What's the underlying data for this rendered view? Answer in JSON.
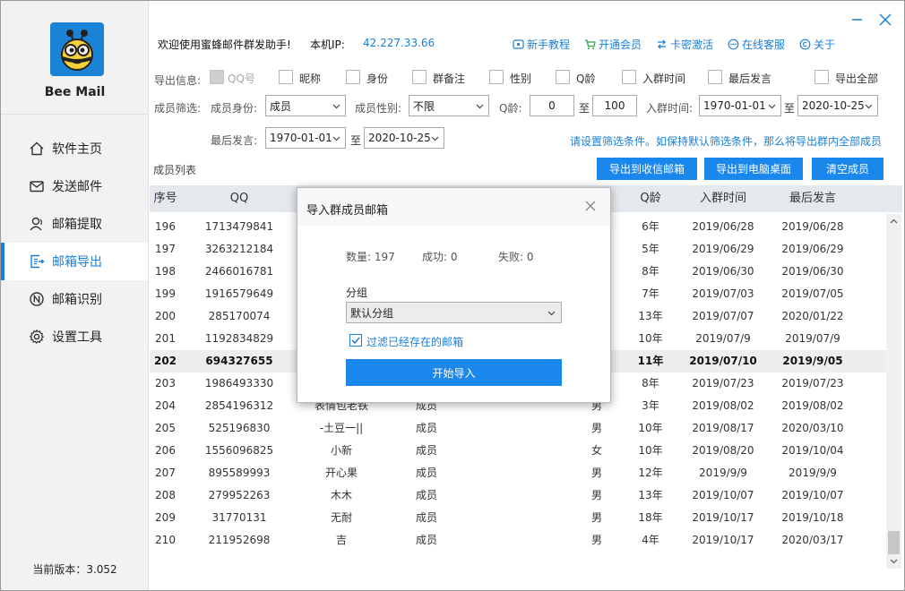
{
  "app": {
    "name": "Bee Mail",
    "version_text": "当前版本：3.052"
  },
  "sidebar": {
    "items": [
      {
        "label": "软件主页",
        "icon": "home-icon"
      },
      {
        "label": "发送邮件",
        "icon": "mail-icon"
      },
      {
        "label": "邮箱提取",
        "icon": "user-icon"
      },
      {
        "label": "邮箱导出",
        "icon": "export-icon"
      },
      {
        "label": "邮箱识别",
        "icon": "identify-icon"
      },
      {
        "label": "设置工具",
        "icon": "gear-icon"
      }
    ],
    "active_index": 3
  },
  "topbar": {
    "welcome": "欢迎使用蜜蜂邮件群发助手!",
    "ip_label": "本机IP:",
    "ip_value": "42.227.33.66",
    "links": [
      "新手教程",
      "开通会员",
      "卡密激活",
      "在线客服",
      "关于"
    ]
  },
  "export_info": {
    "label": "导出信息:",
    "options": [
      "QQ号",
      "昵称",
      "身份",
      "群备注",
      "性别",
      "Q龄",
      "入群时间",
      "最后发言",
      "导出全部"
    ]
  },
  "filter": {
    "label": "成员筛选:",
    "identity_label": "成员身份:",
    "identity_value": "成员",
    "gender_label": "成员性别:",
    "gender_value": "不限",
    "qage_label": "Q龄:",
    "qage_from": "0",
    "to": "至",
    "qage_to": "100",
    "join_label": "入群时间:",
    "join_from": "1970-01-01",
    "join_to": "2020-10-25",
    "last_label": "最后发言:",
    "last_from": "1970-01-01",
    "last_to": "2020-10-25",
    "hint": "请设置筛选条件。如保持默认筛选条件，那么将导出群内全部成员"
  },
  "list": {
    "title": "成员列表",
    "buttons": [
      "导出到收信邮箱",
      "导出到电脑桌面",
      "清空成员"
    ],
    "headers": [
      "序号",
      "QQ",
      "Q龄",
      "入群时间",
      "最后发言"
    ],
    "rows": [
      {
        "no": "196",
        "qq": "1713479841",
        "nick": "",
        "role": "",
        "sex": "",
        "age": "6年",
        "join": "2019/06/28",
        "last": "2019/06/28"
      },
      {
        "no": "197",
        "qq": "3263212184",
        "nick": "",
        "role": "",
        "sex": "",
        "age": "5年",
        "join": "2019/06/29",
        "last": "2019/06/29"
      },
      {
        "no": "198",
        "qq": "2466016781",
        "nick": "",
        "role": "",
        "sex": "",
        "age": "8年",
        "join": "2019/06/30",
        "last": "2019/06/30"
      },
      {
        "no": "199",
        "qq": "1916579649",
        "nick": "",
        "role": "",
        "sex": "",
        "age": "7年",
        "join": "2019/07/03",
        "last": "2019/07/05"
      },
      {
        "no": "200",
        "qq": "285170074",
        "nick": "",
        "role": "",
        "sex": "",
        "age": "13年",
        "join": "2019/07/07",
        "last": "2020/01/22"
      },
      {
        "no": "201",
        "qq": "1192834829",
        "nick": "",
        "role": "",
        "sex": "",
        "age": "10年",
        "join": "2019/07/9",
        "last": "2019/07/9"
      },
      {
        "no": "202",
        "qq": "694327655",
        "nick": "",
        "role": "",
        "sex": "",
        "age": "11年",
        "join": "2019/07/10",
        "last": "2019/9/05"
      },
      {
        "no": "203",
        "qq": "1986493330",
        "nick": "",
        "role": "",
        "sex": "",
        "age": "8年",
        "join": "2019/07/23",
        "last": "2019/07/23"
      },
      {
        "no": "204",
        "qq": "2854196312",
        "nick": "表情包老铁",
        "role": "成员",
        "sex": "男",
        "age": "3年",
        "join": "2019/08/02",
        "last": "2019/08/02"
      },
      {
        "no": "205",
        "qq": "525196830",
        "nick": "-土豆一||",
        "role": "成员",
        "sex": "男",
        "age": "10年",
        "join": "2019/08/17",
        "last": "2020/03/10"
      },
      {
        "no": "206",
        "qq": "1556096825",
        "nick": "小新",
        "role": "成员",
        "sex": "女",
        "age": "10年",
        "join": "2019/08/20",
        "last": "2019/10/04"
      },
      {
        "no": "207",
        "qq": "895589993",
        "nick": "开心果",
        "role": "成员",
        "sex": "男",
        "age": "12年",
        "join": "2019/9/9",
        "last": "2019/9/9"
      },
      {
        "no": "208",
        "qq": "279952263",
        "nick": "木木",
        "role": "成员",
        "sex": "男",
        "age": "13年",
        "join": "2019/10/07",
        "last": "2019/10/07"
      },
      {
        "no": "209",
        "qq": "31770131",
        "nick": "无耐",
        "role": "成员",
        "sex": "男",
        "age": "18年",
        "join": "2019/10/17",
        "last": "2019/10/18"
      },
      {
        "no": "210",
        "qq": "211952698",
        "nick": "吉",
        "role": "成员",
        "sex": "男",
        "age": "4年",
        "join": "2019/10/17",
        "last": "2020/03/17"
      }
    ],
    "selected_index": 6
  },
  "dialog": {
    "title": "导入群成员邮箱",
    "count": "数量: 197",
    "success": "成功: 0",
    "fail": "失败: 0",
    "group_label": "分组",
    "group_value": "默认分组",
    "filter_label": "过滤已经存在的邮箱",
    "start_button": "开始导入"
  },
  "colors": {
    "accent": "#1a87ec",
    "link": "#1a7fd8",
    "logo_bg": "#1a83d6",
    "sidebar_bg": "#f2f2f2",
    "table_head_bg": "#e5e9ee"
  }
}
